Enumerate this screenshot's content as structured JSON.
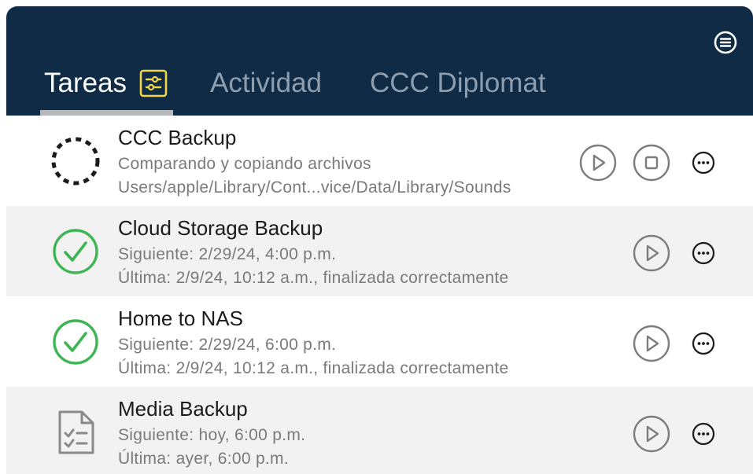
{
  "tabs": [
    {
      "label": "Tareas",
      "active": true
    },
    {
      "label": "Actividad",
      "active": false
    },
    {
      "label": "CCC Diplomat",
      "active": false
    }
  ],
  "icons": {
    "menu": "list-circle-icon",
    "filter": "sliders-icon",
    "play": "play-circle-icon",
    "stop": "stop-circle-icon",
    "more": "ellipsis-circle-icon",
    "running": "spinner-icon",
    "success": "checkmark-circle-icon",
    "scheduled": "checklist-document-icon"
  },
  "colors": {
    "header_bg": "#0f2b46",
    "tab_active": "#ffffff",
    "tab_inactive": "#8e9eae",
    "filter_icon": "#f5d547",
    "success": "#3db553",
    "running": "#1b1b1b"
  },
  "tasks": [
    {
      "name": "CCC Backup",
      "status": "running",
      "line1": "Comparando y copiando archivos",
      "line2": "Users/apple/Library/Cont...vice/Data/Library/Sounds"
    },
    {
      "name": "Cloud Storage Backup",
      "status": "success",
      "line1": "Siguiente: 2/29/24, 4:00 p.m.",
      "line2": "Última: 2/9/24, 10:12 a.m., finalizada correctamente"
    },
    {
      "name": "Home to NAS",
      "status": "success",
      "line1": "Siguiente: 2/29/24, 6:00 p.m.",
      "line2": "Última: 2/9/24, 10:12 a.m., finalizada correctamente"
    },
    {
      "name": "Media Backup",
      "status": "scheduled",
      "line1": "Siguiente: hoy, 6:00 p.m.",
      "line2": "Última: ayer, 6:00 p.m."
    }
  ]
}
